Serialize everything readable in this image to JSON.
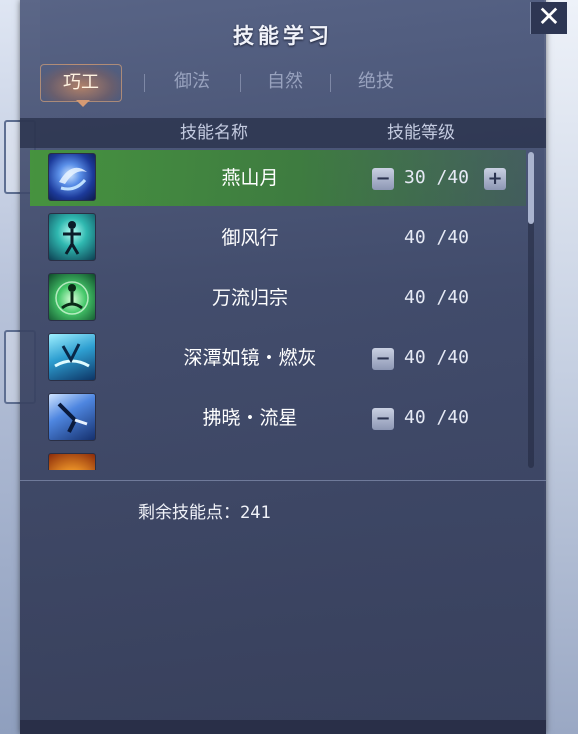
{
  "window": {
    "title": "技能学习",
    "close_label": "✕"
  },
  "tabs": [
    {
      "label": "巧工",
      "active": true
    },
    {
      "label": "御法",
      "active": false
    },
    {
      "label": "自然",
      "active": false
    },
    {
      "label": "绝技",
      "active": false
    }
  ],
  "table": {
    "header_name": "技能名称",
    "header_level": "技能等级"
  },
  "skills": [
    {
      "name": "燕山月",
      "level": "30 /40",
      "icon": "crescent-swirl-icon",
      "minus": "−",
      "plus": "+",
      "selected": true
    },
    {
      "name": "御风行",
      "level": "40 /40",
      "icon": "wind-figure-icon"
    },
    {
      "name": "万流归宗",
      "level": "40 /40",
      "icon": "meditation-aura-icon"
    },
    {
      "name": "深潭如镜・燃灰",
      "level": "40 /40",
      "icon": "water-mirror-icon",
      "minus": "−"
    },
    {
      "name": "拂晓・流星",
      "level": "40 /40",
      "icon": "meteor-kick-icon",
      "minus": "−"
    }
  ],
  "remaining": {
    "label": "剩余技能点：",
    "value": "241"
  },
  "colors": {
    "selected_row": "#4c9a3c",
    "panel": "#3f4a6e",
    "tab_active": "#d59a73"
  }
}
